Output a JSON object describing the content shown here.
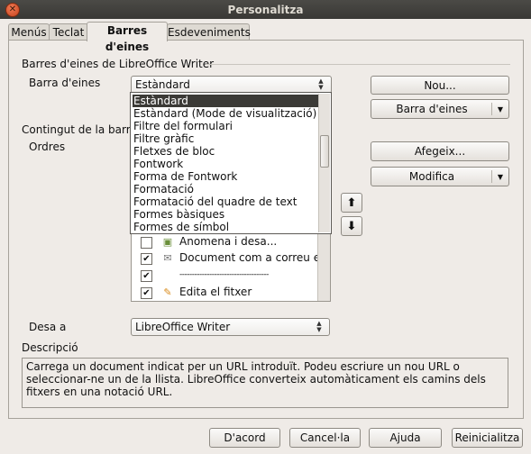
{
  "window": {
    "title": "Personalitza"
  },
  "tabs": [
    {
      "label": "Menús"
    },
    {
      "label": "Teclat"
    },
    {
      "label": "Barres d'eines"
    },
    {
      "label": "Esdeveniments"
    }
  ],
  "toolbars_section": {
    "heading": "Barres d'eines de LibreOffice Writer",
    "toolbar_label": "Barra d'eines",
    "toolbar_value": "Estàndard",
    "new_button": "Nou...",
    "toolbar_menu_button": "Barra d'eines"
  },
  "dropdown": {
    "items": [
      "Estàndard",
      "Estàndard (Mode de visualització)",
      "Filtre del formulari",
      "Filtre gràfic",
      "Fletxes de bloc",
      "Fontwork",
      "Forma de Fontwork",
      "Formatació",
      "Formatació del quadre de text",
      "Formes bàsiques",
      "Formes de símbol"
    ]
  },
  "content_section": {
    "heading": "Contingut de la barra d",
    "commands_label": "Ordres",
    "add_button": "Afegeix...",
    "modify_button": "Modifica",
    "commands": [
      {
        "label": "Anomena i desa...",
        "checked": false,
        "icon": "save-as-icon"
      },
      {
        "label": "Document com a correu ele",
        "checked": true,
        "icon": "email-icon"
      },
      {
        "label": "------------------------------------",
        "checked": true,
        "icon": ""
      },
      {
        "label": "Edita el fitxer",
        "checked": true,
        "icon": "edit-file-icon"
      }
    ]
  },
  "save_in": {
    "label": "Desa a",
    "value": "LibreOffice Writer"
  },
  "description": {
    "label": "Descripció",
    "text": "Carrega un document indicat per un URL introduït. Podeu escriure un nou URL o seleccionar-ne un de la llista. LibreOffice converteix automàticament els camins dels fitxers en una notació URL."
  },
  "footer": {
    "ok": "D'acord",
    "cancel": "Cancel·la",
    "help": "Ajuda",
    "reset": "Reinicialitza"
  }
}
